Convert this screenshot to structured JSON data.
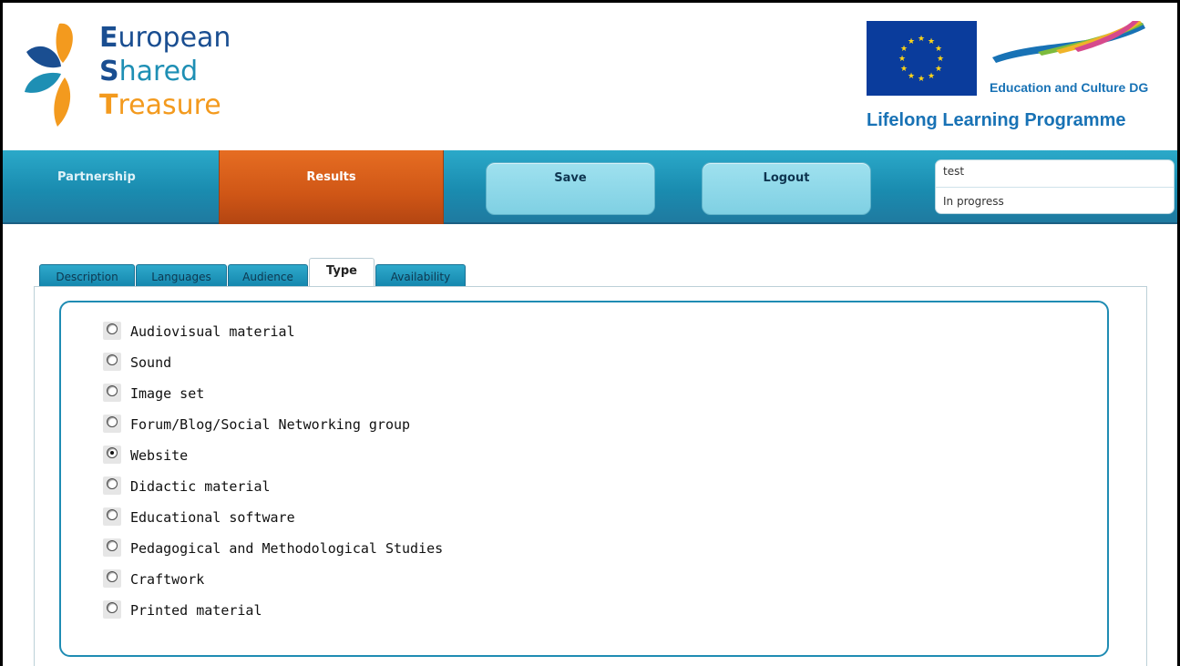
{
  "branding": {
    "logo_line1": "European",
    "logo_line2": "Shared",
    "logo_line3": "Treasure",
    "dg_label": "Education and Culture DG",
    "programme_label": "Lifelong Learning Programme"
  },
  "nav": {
    "partnership": "Partnership",
    "results": "Results",
    "save": "Save",
    "logout": "Logout",
    "project_name": "test",
    "project_status": "In progress"
  },
  "tabs": [
    {
      "label": "Description",
      "active": false
    },
    {
      "label": "Languages",
      "active": false
    },
    {
      "label": "Audience",
      "active": false
    },
    {
      "label": "Type",
      "active": true
    },
    {
      "label": "Availability",
      "active": false
    }
  ],
  "type_options": [
    {
      "label": "Audiovisual material",
      "selected": false
    },
    {
      "label": "Sound",
      "selected": false
    },
    {
      "label": "Image set",
      "selected": false
    },
    {
      "label": "Forum/Blog/Social Networking group",
      "selected": false
    },
    {
      "label": "Website",
      "selected": true
    },
    {
      "label": "Didactic material",
      "selected": false
    },
    {
      "label": "Educational software",
      "selected": false
    },
    {
      "label": "Pedagogical and Methodological Studies",
      "selected": false
    },
    {
      "label": "Craftwork",
      "selected": false
    },
    {
      "label": "Printed material",
      "selected": false
    }
  ],
  "colors": {
    "nav_blue": "#1a8cb0",
    "results_orange": "#cf5616",
    "panel_border": "#1f8cb3",
    "eu_flag": "#0a3c9c",
    "eu_star": "#ffd617"
  }
}
